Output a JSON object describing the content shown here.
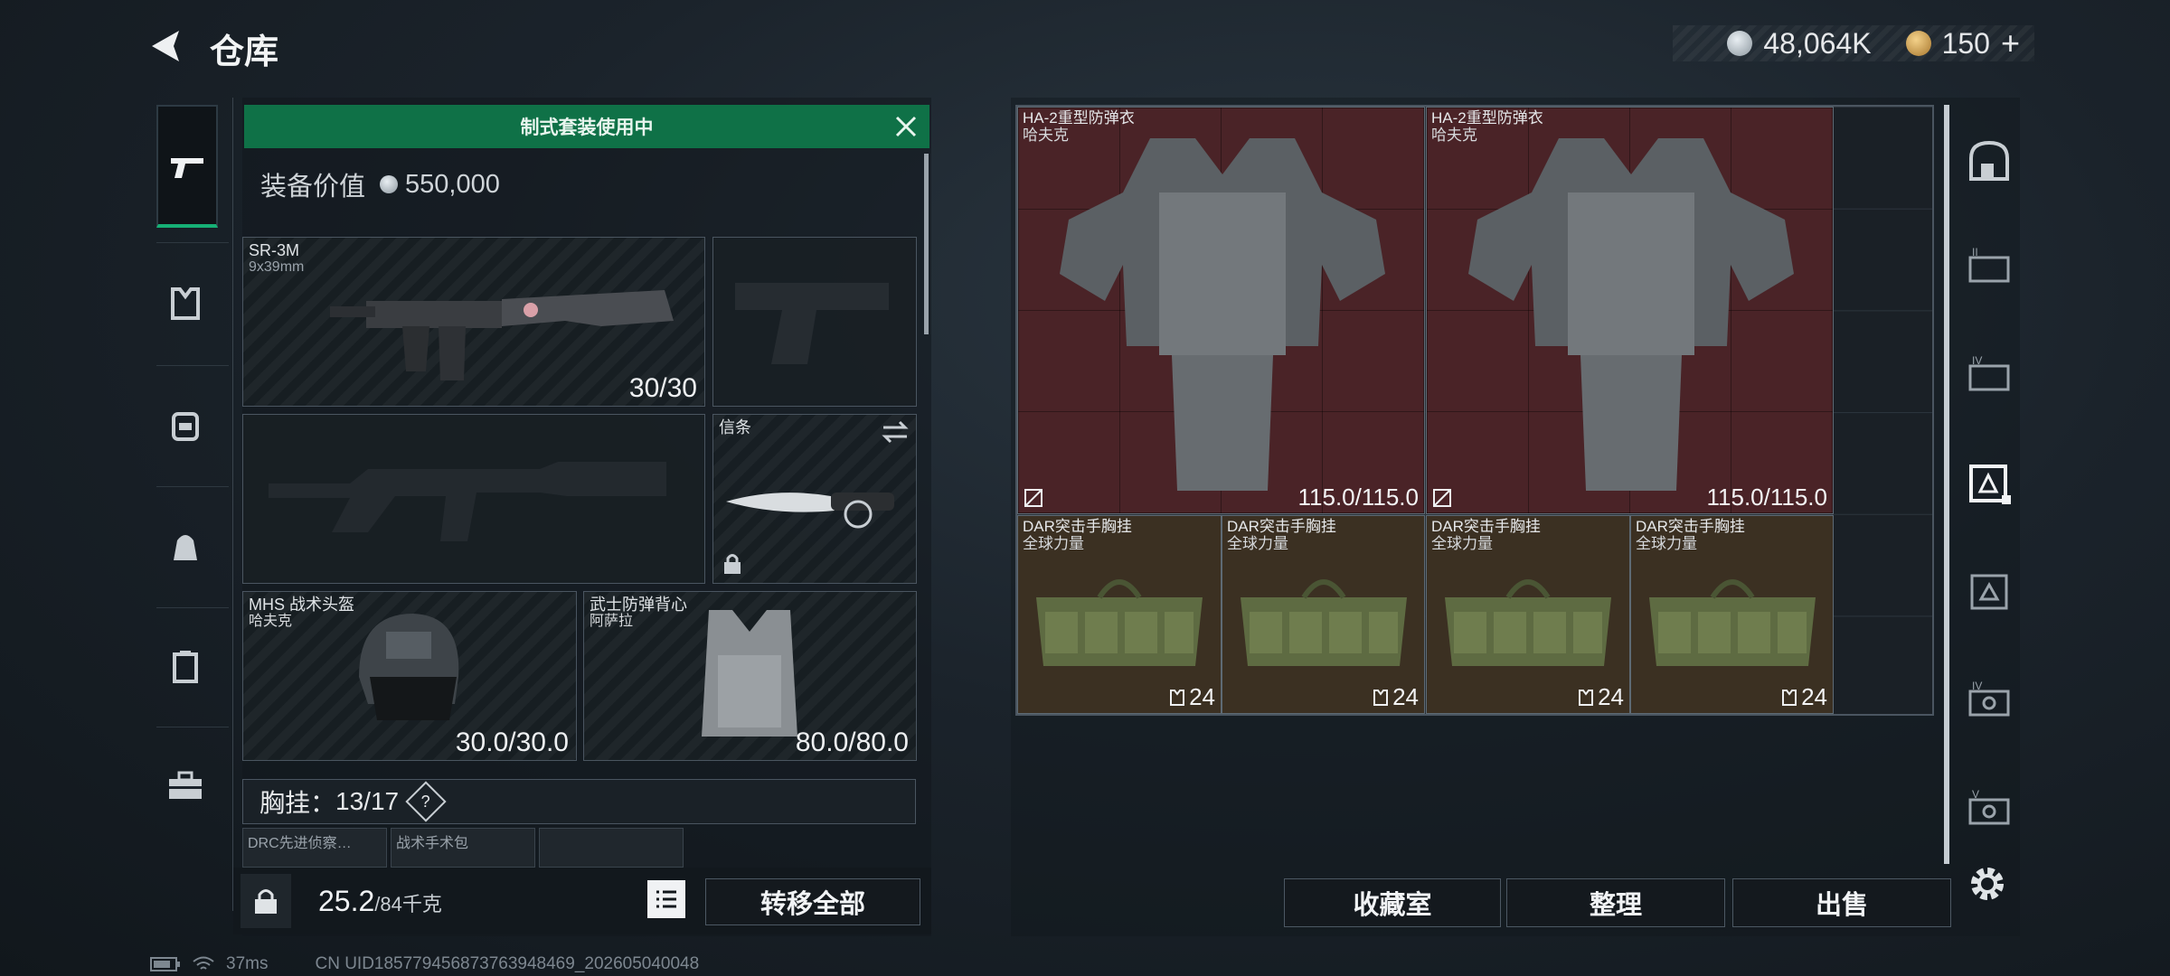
{
  "header": {
    "title": "仓库",
    "back_icon": "back-arrow-icon"
  },
  "currency": {
    "silver": "48,064K",
    "gold": "150",
    "gold_add": "+"
  },
  "left_nav": [
    "gun-icon",
    "vest-icon",
    "backpack-icon",
    "bag-icon",
    "clipboard-icon",
    "toolbox-icon"
  ],
  "loadout": {
    "banner": "制式套装使用中",
    "value_label": "装备价值",
    "value": "550,000",
    "primary": {
      "name": "SR-3M",
      "caliber": "9x39mm",
      "ammo": "30/30"
    },
    "melee": {
      "name": "信条"
    },
    "helmet": {
      "name": "MHS 战术头盔",
      "brand": "哈夫克",
      "durability": "30.0/30.0"
    },
    "armor": {
      "name": "武士防弹背心",
      "brand": "阿萨拉",
      "durability": "80.0/80.0"
    },
    "chest": {
      "label": "胸挂：",
      "capacity": "13/17",
      "help": "?"
    },
    "chest_items": [
      "DRC先进侦察…",
      "战术手术包",
      ""
    ],
    "weight": "25.2",
    "weight_max": "/84千克",
    "move_all": "转移全部"
  },
  "storage": {
    "items": [
      {
        "name": "HA-2重型防弹衣",
        "brand": "哈夫克",
        "durability": "115.0/115.0"
      },
      {
        "name": "HA-2重型防弹衣",
        "brand": "哈夫克",
        "durability": "115.0/115.0"
      },
      {
        "name": "DAR突击手胸挂",
        "brand": "全球力量",
        "capacity": "24"
      },
      {
        "name": "DAR突击手胸挂",
        "brand": "全球力量",
        "capacity": "24"
      },
      {
        "name": "DAR突击手胸挂",
        "brand": "全球力量",
        "capacity": "24"
      },
      {
        "name": "DAR突击手胸挂",
        "brand": "全球力量",
        "capacity": "24"
      }
    ],
    "buttons": {
      "collection": "收藏室",
      "sort": "整理",
      "sell": "出售"
    }
  },
  "status": {
    "ping": "37ms",
    "uid": "CN UID1857794568737639484​69_202605040048"
  }
}
